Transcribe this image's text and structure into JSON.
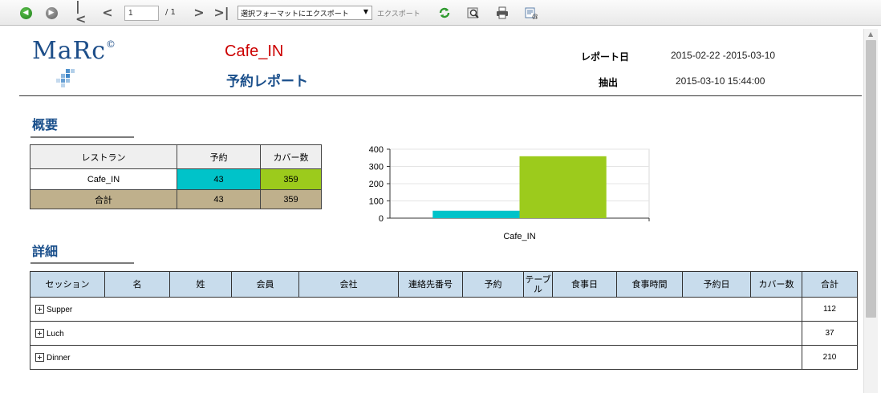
{
  "toolbar": {
    "page_current": "1",
    "page_of": "/ 1",
    "export_format": "選択フォーマットにエクスポート",
    "export_label": "エクスポート"
  },
  "header": {
    "logo_text": "MaRc",
    "logo_copyright": "©",
    "restaurant": "Cafe_IN",
    "report_title": "予約レポート",
    "report_date_label": "レポート日",
    "report_date_value": "2015-02-22 -2015-03-10",
    "extract_label": "抽出",
    "extract_value": "2015-03-10 15:44:00"
  },
  "summary": {
    "title": "概要",
    "headers": [
      "レストラン",
      "予約",
      "カバー数"
    ],
    "rows": [
      {
        "restaurant": "Cafe_IN",
        "reservations": "43",
        "covers": "359"
      }
    ],
    "total": {
      "label": "合計",
      "reservations": "43",
      "covers": "359"
    }
  },
  "chart_data": {
    "type": "bar",
    "categories": [
      "Cafe_IN"
    ],
    "series": [
      {
        "values": [
          43
        ],
        "color": "#00c3c9"
      },
      {
        "values": [
          359
        ],
        "color": "#9ccb1c"
      }
    ],
    "ylim": [
      0,
      400
    ],
    "yticks": [
      "0",
      "100",
      "200",
      "300",
      "400"
    ],
    "xlabel": "",
    "ylabel": "",
    "title": ""
  },
  "detail": {
    "title": "詳細",
    "headers": [
      "セッション",
      "名",
      "姓",
      "会員",
      "会社",
      "連絡先番号",
      "予約",
      "テーブル",
      "食事日",
      "食事時間",
      "予約日",
      "カバー数",
      "合計"
    ],
    "rows": [
      {
        "session": "Supper",
        "total": "112"
      },
      {
        "session": "Luch",
        "total": "37"
      },
      {
        "session": "Dinner",
        "total": "210"
      }
    ]
  },
  "colors": {
    "accent_blue": "#1a4f8b",
    "restaurant_red": "#cc0000",
    "reservations_cyan": "#00c3c9",
    "covers_green": "#9ccb1c",
    "total_row": "#bfb08c",
    "detail_header": "#c8dcec"
  }
}
